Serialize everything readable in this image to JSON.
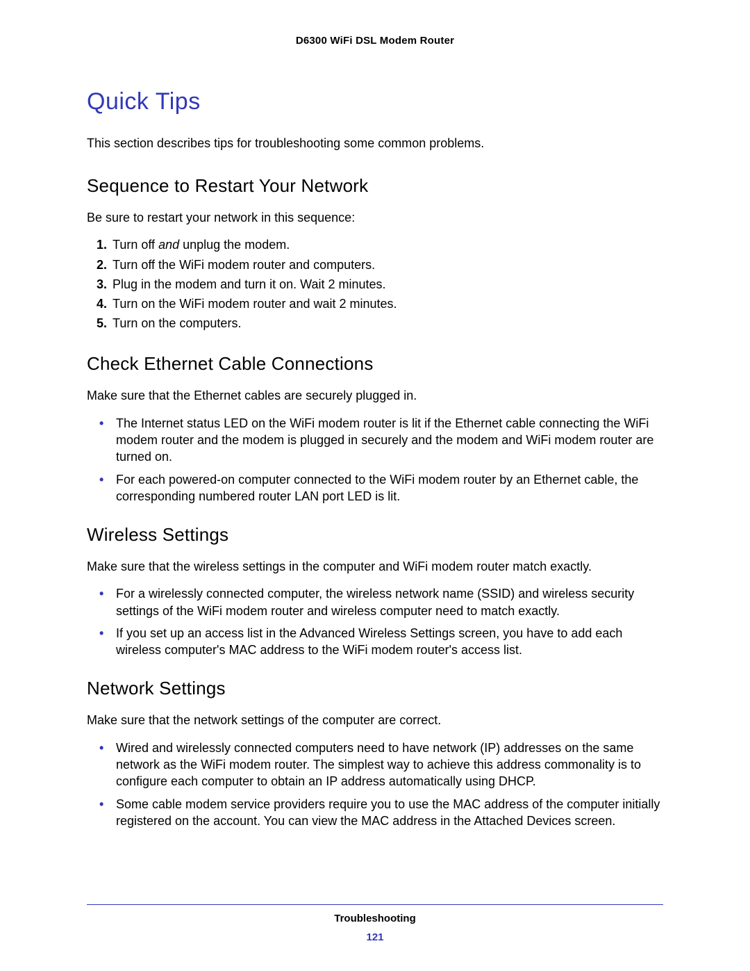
{
  "header": {
    "product": "D6300 WiFi DSL Modem Router"
  },
  "title": "Quick Tips",
  "intro": "This section describes tips for troubleshooting some common problems.",
  "sections": {
    "sequence": {
      "heading": "Sequence to Restart Your Network",
      "lead": "Be sure to restart your network in this sequence:",
      "steps": [
        {
          "num": "1.",
          "prefix": "Turn off ",
          "italic": "and",
          "suffix": " unplug the modem."
        },
        {
          "num": "2.",
          "text": "Turn off the WiFi modem router and computers."
        },
        {
          "num": "3.",
          "text": "Plug in the modem and turn it on. Wait 2 minutes."
        },
        {
          "num": "4.",
          "text": "Turn on the WiFi modem router and wait 2 minutes."
        },
        {
          "num": "5.",
          "text": "Turn on the computers."
        }
      ]
    },
    "ethernet": {
      "heading": "Check Ethernet Cable Connections",
      "lead": "Make sure that the Ethernet cables are securely plugged in.",
      "bullets": [
        "The Internet status LED on the WiFi modem router is lit if the Ethernet cable connecting the WiFi modem router and the modem is plugged in securely and the modem and WiFi modem router are turned on.",
        "For each powered-on computer connected to the WiFi modem router by an Ethernet cable, the corresponding numbered router LAN port LED is lit."
      ]
    },
    "wireless": {
      "heading": "Wireless Settings",
      "lead": "Make sure that the wireless settings in the computer and WiFi modem router match exactly.",
      "bullets": [
        "For a wirelessly connected computer, the wireless network name (SSID) and wireless security settings of the WiFi modem router and wireless computer need to match exactly.",
        "If you set up an access list in the Advanced Wireless Settings screen, you have to add each wireless computer's MAC address to the WiFi modem router's access list."
      ]
    },
    "network": {
      "heading": "Network Settings",
      "lead": "Make sure that the network settings of the computer are correct.",
      "bullets": [
        "Wired and wirelessly connected computers need to have network (IP) addresses on the same network as the WiFi modem router. The simplest way to achieve this address commonality is to configure each computer to obtain an IP address automatically using DHCP.",
        "Some cable modem service providers require you to use the MAC address of the computer initially registered on the account. You can view the MAC address in the Attached Devices screen."
      ]
    }
  },
  "footer": {
    "section": "Troubleshooting",
    "page": "121"
  }
}
